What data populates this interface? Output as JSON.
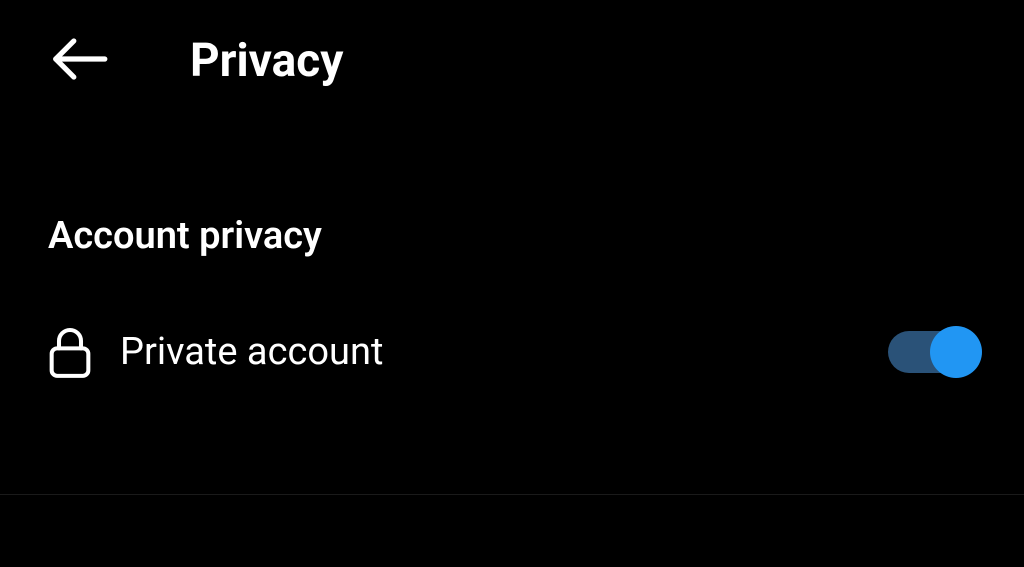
{
  "header": {
    "title": "Privacy"
  },
  "section": {
    "title": "Account privacy"
  },
  "settings": {
    "private_account": {
      "label": "Private account",
      "enabled": true
    }
  }
}
